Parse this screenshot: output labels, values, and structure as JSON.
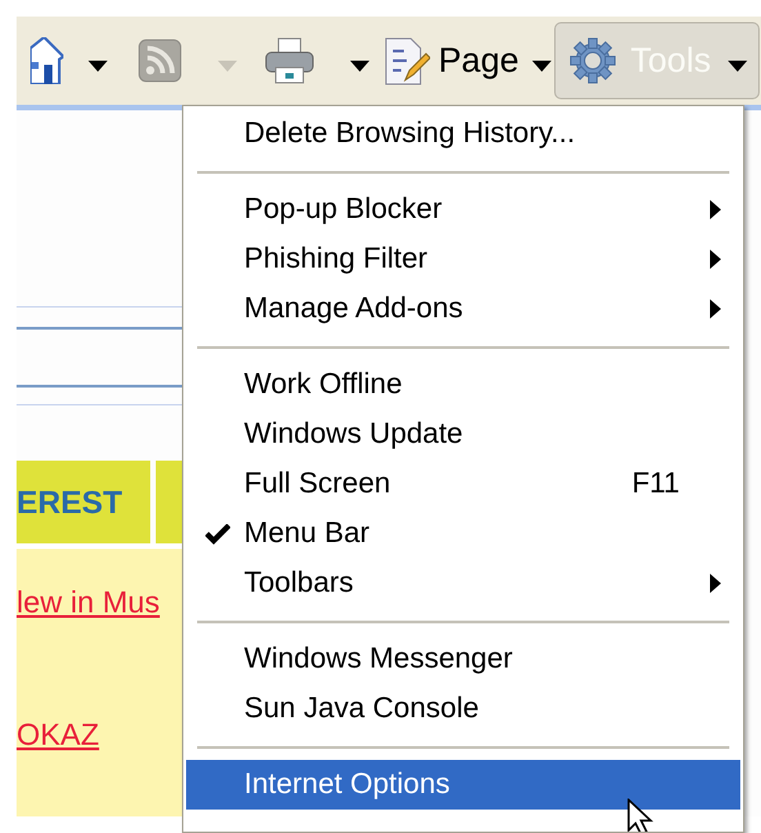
{
  "toolbar": {
    "items": [
      {
        "kind": "home",
        "disabled": false,
        "pressed": false
      },
      {
        "kind": "feeds",
        "disabled": true,
        "pressed": false
      },
      {
        "kind": "print",
        "disabled": false,
        "pressed": false
      },
      {
        "kind": "page",
        "label": "Page",
        "disabled": false,
        "pressed": false
      },
      {
        "kind": "tools",
        "label": "Tools",
        "disabled": false,
        "pressed": true
      }
    ]
  },
  "page": {
    "tab_label": "EREST",
    "links": [
      "lew in Mus",
      "OKAZ"
    ]
  },
  "tools_menu": {
    "sections": [
      [
        {
          "label": "Delete Browsing History...",
          "submenu": false,
          "checked": false,
          "selected": false
        }
      ],
      [
        {
          "label": "Pop-up Blocker",
          "submenu": true,
          "checked": false,
          "selected": false
        },
        {
          "label": "Phishing Filter",
          "submenu": true,
          "checked": false,
          "selected": false
        },
        {
          "label": "Manage Add-ons",
          "submenu": true,
          "checked": false,
          "selected": false
        }
      ],
      [
        {
          "label": "Work Offline",
          "submenu": false,
          "checked": false,
          "selected": false
        },
        {
          "label": "Windows Update",
          "submenu": false,
          "checked": false,
          "selected": false
        },
        {
          "label": "Full Screen",
          "shortcut": "F11",
          "submenu": false,
          "checked": false,
          "selected": false
        },
        {
          "label": "Menu Bar",
          "submenu": false,
          "checked": true,
          "selected": false
        },
        {
          "label": "Toolbars",
          "submenu": true,
          "checked": false,
          "selected": false
        }
      ],
      [
        {
          "label": "Windows Messenger",
          "submenu": false,
          "checked": false,
          "selected": false
        },
        {
          "label": "Sun Java Console",
          "submenu": false,
          "checked": false,
          "selected": false
        }
      ],
      [
        {
          "label": "Internet Options",
          "submenu": false,
          "checked": false,
          "selected": true
        }
      ]
    ]
  }
}
